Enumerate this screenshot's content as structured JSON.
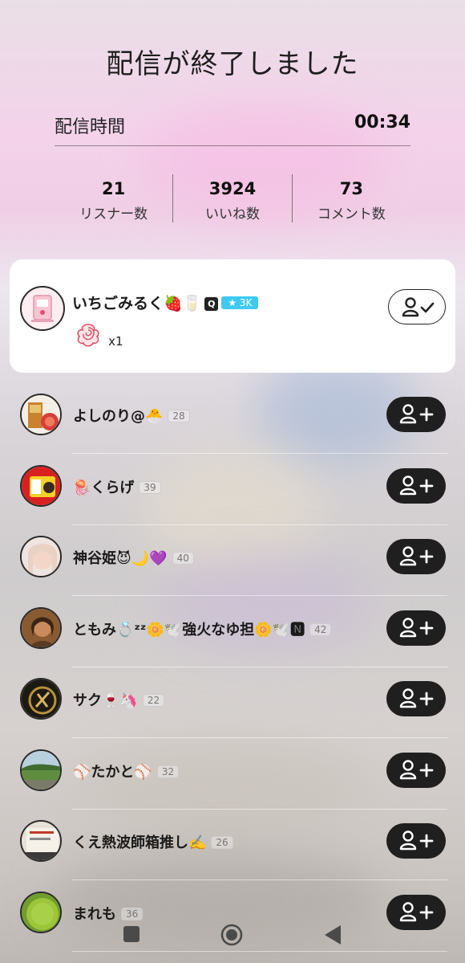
{
  "header": {
    "title": "配信が終了しました"
  },
  "duration": {
    "label": "配信時間",
    "value": "00:34"
  },
  "stats": [
    {
      "value": "21",
      "label": "リスナー数"
    },
    {
      "value": "3924",
      "label": "いいね数"
    },
    {
      "value": "73",
      "label": "コメント数"
    }
  ],
  "host": {
    "name": "いちごみるく🍓🥛",
    "verify_glyph": "Q",
    "fan_badge": "3K",
    "gift_count": "x1",
    "button": "following"
  },
  "listeners": [
    {
      "name": "よしのり@🐣",
      "level": "28"
    },
    {
      "name": "🪼くらげ",
      "level": "39"
    },
    {
      "name": "神谷姫😈🌙💜",
      "level": "40"
    },
    {
      "name": "ともみ💍ᶻᶻ🌼🕊️強火なゆ担🌼🕊️🅽",
      "level": "42"
    },
    {
      "name": "サク🍷🦄",
      "level": "22"
    },
    {
      "name": "⚾たかと⚾",
      "level": "32"
    },
    {
      "name": "くえ熱波師箱推し✍️",
      "level": "26"
    },
    {
      "name": "まれも",
      "level": "36"
    }
  ],
  "colors": {
    "follow_button": "#1f1f1f",
    "fan_badge": "#3fc9f0",
    "card_bg": "#ffffff"
  },
  "nav": [
    "square-icon",
    "home-circle-icon",
    "back-triangle-icon"
  ]
}
